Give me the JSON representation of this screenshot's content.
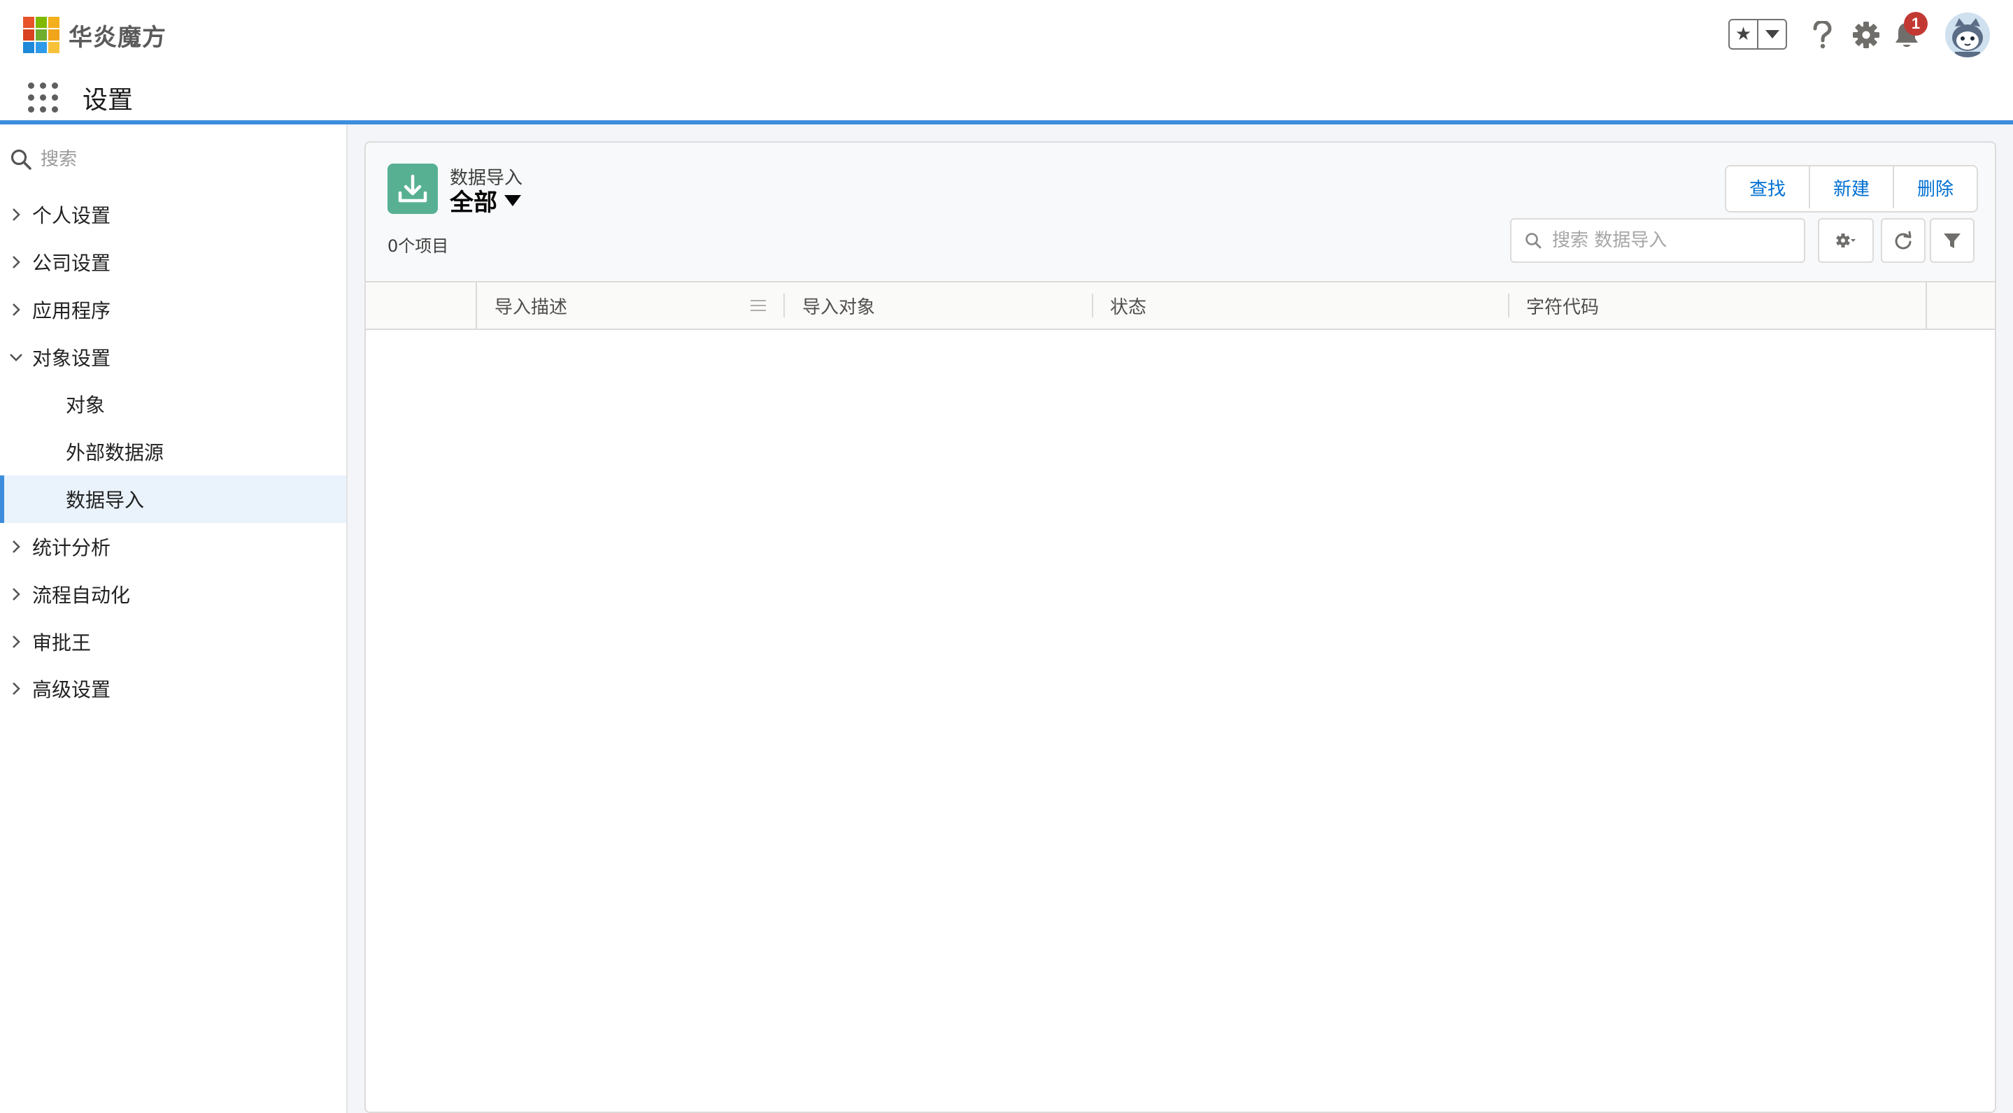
{
  "header": {
    "app_name": "华炎魔方",
    "notification_count": "1",
    "page_title": "设置",
    "colors": {
      "accent": "#3d8ddc",
      "badge": "#c23934",
      "brand_icon": "#58b093"
    },
    "icons": [
      "favorites-star-icon",
      "favorites-dropdown-icon",
      "help-icon",
      "settings-gear-icon",
      "notification-bell-icon",
      "user-avatar",
      "app-launcher-icon"
    ]
  },
  "sidebar": {
    "search_placeholder": "搜索",
    "items": [
      {
        "label": "个人设置",
        "state": "collapsed"
      },
      {
        "label": "公司设置",
        "state": "collapsed"
      },
      {
        "label": "应用程序",
        "state": "collapsed"
      },
      {
        "label": "对象设置",
        "state": "expanded"
      },
      {
        "label": "对象",
        "state": "child"
      },
      {
        "label": "外部数据源",
        "state": "child"
      },
      {
        "label": "数据导入",
        "state": "child-selected"
      },
      {
        "label": "统计分析",
        "state": "collapsed"
      },
      {
        "label": "流程自动化",
        "state": "collapsed"
      },
      {
        "label": "审批王",
        "state": "collapsed"
      },
      {
        "label": "高级设置",
        "state": "collapsed"
      }
    ]
  },
  "list_view": {
    "object_label": "数据导入",
    "view_name": "全部",
    "item_count": "0个项目",
    "buttons": {
      "find": "查找",
      "new": "新建",
      "delete": "删除"
    },
    "search_placeholder": "搜索 数据导入",
    "columns": [
      "导入描述",
      "导入对象",
      "状态",
      "字符代码"
    ],
    "rows": []
  }
}
